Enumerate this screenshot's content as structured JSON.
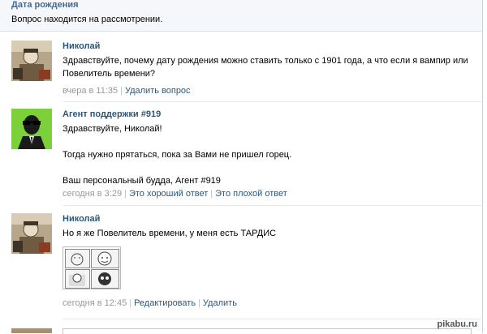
{
  "question": {
    "title": "Дата рождения",
    "status": "Вопрос находится на рассмотрении."
  },
  "messages": [
    {
      "author": "Николай",
      "lines": [
        "Здравствуйте, почему дату рождения можно ставить только с 1901 года, а что если я вампир или Повелитель времени?"
      ],
      "time": "вчера в 11:35",
      "actions": [
        "Удалить вопрос"
      ]
    },
    {
      "author": "Агент поддержки #919",
      "lines": [
        "Здравствуйте, Николай!",
        "",
        "Тогда нужно прятаться, пока за Вами не пришел горец.",
        "",
        "Ваш персональный будда, Агент #919"
      ],
      "time": "сегодня в 3:29",
      "actions": [
        "Это хороший ответ",
        "Это плохой ответ"
      ]
    },
    {
      "author": "Николай",
      "lines": [
        "Но я же Повелитель времени, у меня есть ТАРДИС"
      ],
      "time": "сегодня в 12:45",
      "actions": [
        "Редактировать",
        "Удалить"
      ]
    }
  ],
  "watermark": "pikabu.ru",
  "colors": {
    "link": "#2b587a",
    "header_title": "#45688e",
    "header_bg": "#f5f7fa",
    "agent_avatar_bg": "#7cd13a"
  }
}
